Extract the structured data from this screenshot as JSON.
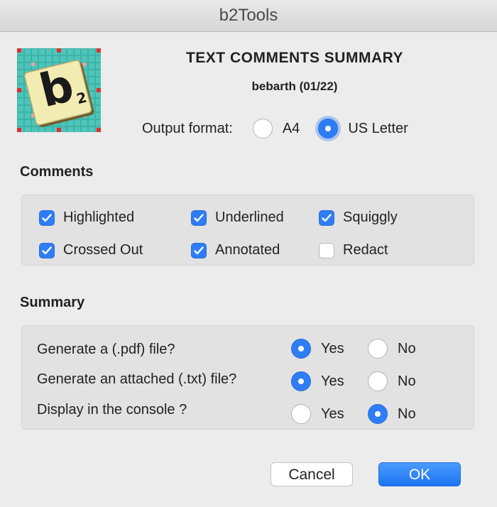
{
  "window": {
    "title": "b2Tools"
  },
  "header": {
    "title": "TEXT COMMENTS SUMMARY",
    "subtitle": "bebarth (01/22)"
  },
  "logo": {
    "letter": "b",
    "subscript": "2"
  },
  "output_format": {
    "label": "Output format:",
    "options": [
      {
        "label": "A4",
        "selected": false
      },
      {
        "label": "US Letter",
        "selected": true
      }
    ]
  },
  "comments": {
    "label": "Comments",
    "items": [
      {
        "label": "Highlighted",
        "checked": true
      },
      {
        "label": "Underlined",
        "checked": true
      },
      {
        "label": "Squiggly",
        "checked": true
      },
      {
        "label": "Crossed Out",
        "checked": true
      },
      {
        "label": "Annotated",
        "checked": true
      },
      {
        "label": "Redact",
        "checked": false
      }
    ]
  },
  "summary": {
    "label": "Summary",
    "rows": [
      {
        "question": "Generate a (.pdf) file?",
        "yes": "Yes",
        "no": "No",
        "value": "Yes"
      },
      {
        "question": "Generate an attached (.txt) file?",
        "yes": "Yes",
        "no": "No",
        "value": "Yes"
      },
      {
        "question": "Display in the console ?",
        "yes": "Yes",
        "no": "No",
        "value": "No"
      }
    ]
  },
  "buttons": {
    "cancel": "Cancel",
    "ok": "OK"
  },
  "colors": {
    "accent": "#2f7df6",
    "background": "#ececec",
    "panel": "#e2e2e2"
  }
}
